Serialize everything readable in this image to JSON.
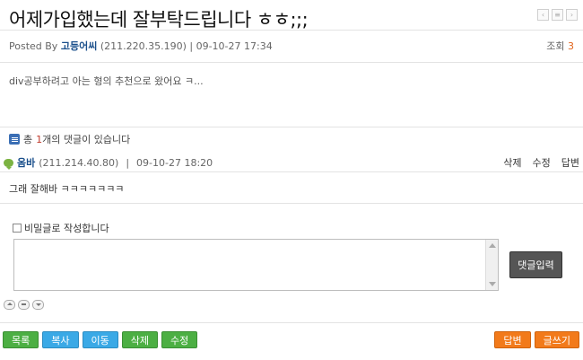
{
  "post": {
    "title": "어제가입했는데 잘부탁드립니다 ㅎㅎ;;;",
    "posted_by_label": "Posted By",
    "author": "고등어씨",
    "ip": "(211.220.35.190)",
    "separator": "|",
    "date": "09-10-27 17:34",
    "views_label": "조회",
    "views": "3",
    "body": "div공부하려고 아는 형의 추천으로 왔어요 ㅋ..."
  },
  "nav": {
    "prev": "‹",
    "list": "≡",
    "next": "›"
  },
  "comments": {
    "prefix": "총",
    "count": "1",
    "suffix": "개의 댓글이 있습니다",
    "items": [
      {
        "author": "옴바",
        "ip": "(211.214.40.80)",
        "separator": "|",
        "date": "09-10-27 18:20",
        "delete_label": "삭제",
        "edit_label": "수정",
        "reply_label": "답변",
        "text": "그래 잘해바 ㅋㅋㅋㅋㅋㅋㅋ"
      }
    ]
  },
  "form": {
    "secret_label": "비밀글로 작성합니다",
    "comment_value": "",
    "submit_label": "댓글입력"
  },
  "buttons": {
    "list": "목록",
    "copy": "복사",
    "move": "이동",
    "delete": "삭제",
    "edit": "수정",
    "reply": "답변",
    "write": "글쓰기"
  },
  "colors": {
    "green": "#4caf43",
    "blue": "#3aa9e6",
    "orange": "#f27a1a",
    "author": "#1a4f8b"
  }
}
